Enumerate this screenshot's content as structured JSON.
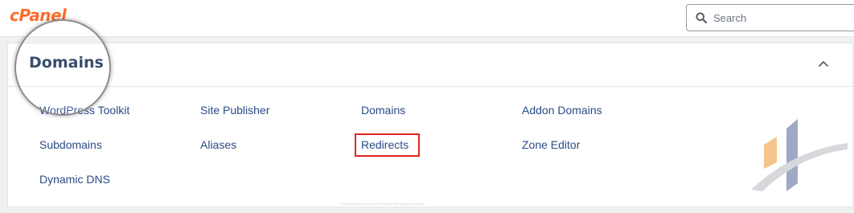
{
  "app": {
    "logo": "cPanel"
  },
  "search": {
    "placeholder": "Search"
  },
  "panel": {
    "title": "Domains",
    "collapse_icon": "chevron-up-icon",
    "items": [
      {
        "label": "WordPress Toolkit"
      },
      {
        "label": "Site Publisher"
      },
      {
        "label": "Domains"
      },
      {
        "label": "Addon Domains"
      },
      {
        "label": "Subdomains"
      },
      {
        "label": "Aliases"
      },
      {
        "label": "Redirects",
        "highlighted": true
      },
      {
        "label": "Zone Editor"
      },
      {
        "label": "Dynamic DNS"
      }
    ]
  },
  "footer": {
    "note": "Provided with the account of Rafael. Full account of Rafael"
  },
  "colors": {
    "brand": "#ff6c2c",
    "link": "#2b4a86",
    "heading": "#1d3557",
    "highlight": "#e3241b"
  }
}
